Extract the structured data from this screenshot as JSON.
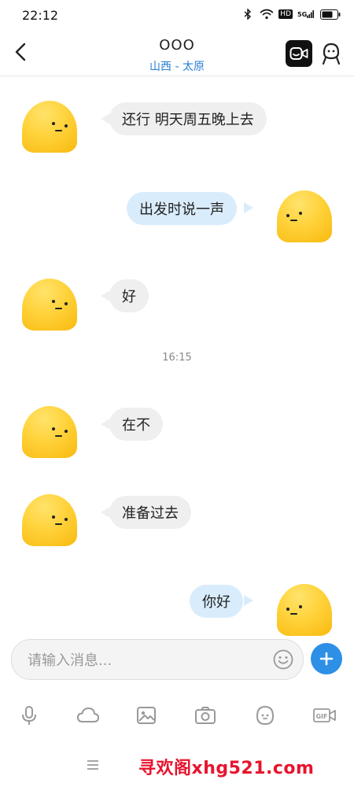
{
  "status_bar": {
    "time": "22:12",
    "hd": "HD",
    "network": "5G"
  },
  "header": {
    "title": "OOO",
    "subtitle": "山西 - 太原"
  },
  "messages": [
    {
      "side": "in",
      "text": "还行 明天周五晚上去"
    },
    {
      "side": "out",
      "text": "出发时说一声"
    },
    {
      "side": "in",
      "text": "好"
    },
    {
      "side": "in",
      "text": "在不"
    },
    {
      "side": "in",
      "text": "准备过去"
    },
    {
      "side": "out",
      "text": "你好"
    }
  ],
  "timestamp": "16:15",
  "input": {
    "placeholder": "请输入消息..."
  },
  "toolbar": {
    "gif_label": "GIF"
  },
  "watermark": "寻欢阁xhg521.com",
  "colors": {
    "accent": "#2d8fe6",
    "outgoing_bubble": "#d9ecfb",
    "incoming_bubble": "#efefef",
    "avatar": "#ffd23a"
  }
}
